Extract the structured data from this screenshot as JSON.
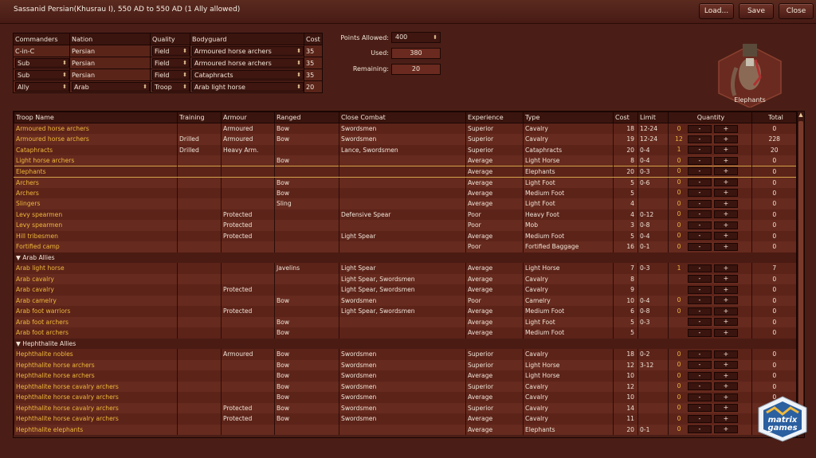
{
  "window": {
    "title": "Sassanid Persian(Khusrau I), 550 AD to 550 AD (1 Ally allowed)",
    "load": "Load...",
    "save": "Save",
    "close": "Close"
  },
  "commanders": {
    "headers": [
      "Commanders",
      "Nation",
      "Quality",
      "Bodyguard",
      "Cost"
    ],
    "rows": [
      {
        "cmd": "C-in-C",
        "nation": "Persian",
        "quality": "Field",
        "bodyguard": "Armoured horse archers",
        "cost": "35",
        "cmd_sel": false,
        "nat_sel": false
      },
      {
        "cmd": "Sub",
        "nation": "Persian",
        "quality": "Field",
        "bodyguard": "Armoured horse archers",
        "cost": "35",
        "cmd_sel": true,
        "nat_sel": false
      },
      {
        "cmd": "Sub",
        "nation": "Persian",
        "quality": "Field",
        "bodyguard": "Cataphracts",
        "cost": "35",
        "cmd_sel": true,
        "nat_sel": false
      },
      {
        "cmd": "Ally",
        "nation": "Arab",
        "quality": "Troop",
        "bodyguard": "Arab light horse",
        "cost": "20",
        "cmd_sel": true,
        "nat_sel": true
      }
    ]
  },
  "points": {
    "allowed_label": "Points Allowed:",
    "allowed": "400",
    "used_label": "Used:",
    "used": "380",
    "remaining_label": "Remaining:",
    "remaining": "20"
  },
  "unit_preview": {
    "caption": "Elephants"
  },
  "troops": {
    "headers": [
      "Troop Name",
      "Training",
      "Armour",
      "Ranged",
      "Close Combat",
      "Experience",
      "Type",
      "Cost",
      "Limit",
      "Quantity",
      "Total"
    ],
    "minus": "-",
    "plus": "+",
    "rows": [
      {
        "name": "Armoured horse archers",
        "training": "",
        "armour": "Armoured",
        "ranged": "Bow",
        "close": "Swordsmen",
        "exp": "Superior",
        "type": "Cavalry",
        "cost": "18",
        "limit": "12-24",
        "qty": "0",
        "total": "0",
        "btn": true
      },
      {
        "name": "Armoured horse archers",
        "training": "Drilled",
        "armour": "Armoured",
        "ranged": "Bow",
        "close": "Swordsmen",
        "exp": "Superior",
        "type": "Cavalry",
        "cost": "19",
        "limit": "12-24",
        "qty": "12",
        "total": "228",
        "btn": true
      },
      {
        "name": "Cataphracts",
        "training": "Drilled",
        "armour": "Heavy Arm.",
        "ranged": "",
        "close": "Lance, Swordsmen",
        "exp": "Superior",
        "type": "Cataphracts",
        "cost": "20",
        "limit": "0-4",
        "qty": "1",
        "total": "20",
        "btn": true
      },
      {
        "name": "Light horse archers",
        "training": "",
        "armour": "",
        "ranged": "Bow",
        "close": "",
        "exp": "Average",
        "type": "Light Horse",
        "cost": "8",
        "limit": "0-4",
        "qty": "0",
        "total": "0",
        "btn": true
      },
      {
        "name": "Elephants",
        "training": "",
        "armour": "",
        "ranged": "",
        "close": "",
        "exp": "Average",
        "type": "Elephants",
        "cost": "20",
        "limit": "0-3",
        "qty": "0",
        "total": "0",
        "btn": true,
        "hl": true
      },
      {
        "name": "Archers",
        "training": "",
        "armour": "",
        "ranged": "Bow",
        "close": "",
        "exp": "Average",
        "type": "Light Foot",
        "cost": "5",
        "limit": "0-6",
        "qty": "0",
        "total": "0",
        "btn": true
      },
      {
        "name": "Archers",
        "training": "",
        "armour": "",
        "ranged": "Bow",
        "close": "",
        "exp": "Average",
        "type": "Medium Foot",
        "cost": "5",
        "limit": "",
        "qty": "0",
        "total": "0",
        "btn": true
      },
      {
        "name": "Slingers",
        "training": "",
        "armour": "",
        "ranged": "Sling",
        "close": "",
        "exp": "Average",
        "type": "Light Foot",
        "cost": "4",
        "limit": "",
        "qty": "0",
        "total": "0",
        "btn": true
      },
      {
        "name": "Levy spearmen",
        "training": "",
        "armour": "Protected",
        "ranged": "",
        "close": "Defensive Spear",
        "exp": "Poor",
        "type": "Heavy Foot",
        "cost": "4",
        "limit": "0-12",
        "qty": "0",
        "total": "0",
        "btn": true
      },
      {
        "name": "Levy spearmen",
        "training": "",
        "armour": "Protected",
        "ranged": "",
        "close": "",
        "exp": "Poor",
        "type": "Mob",
        "cost": "3",
        "limit": "0-8",
        "qty": "0",
        "total": "0",
        "btn": true
      },
      {
        "name": "Hill tribesmen",
        "training": "",
        "armour": "Protected",
        "ranged": "",
        "close": "Light Spear",
        "exp": "Average",
        "type": "Medium Foot",
        "cost": "5",
        "limit": "0-4",
        "qty": "0",
        "total": "0",
        "btn": true
      },
      {
        "name": "Fortified camp",
        "training": "",
        "armour": "",
        "ranged": "",
        "close": "",
        "exp": "Poor",
        "type": "Fortified Baggage",
        "cost": "16",
        "limit": "0-1",
        "qty": "0",
        "total": "0",
        "btn": true
      },
      {
        "group": "Arab Allies"
      },
      {
        "name": "Arab light horse",
        "training": "",
        "armour": "",
        "ranged": "Javelins",
        "close": "Light Spear",
        "exp": "Average",
        "type": "Light Horse",
        "cost": "7",
        "limit": "0-3",
        "qty": "1",
        "total": "7",
        "btn": true
      },
      {
        "name": "Arab cavalry",
        "training": "",
        "armour": "",
        "ranged": "",
        "close": "Light Spear, Swordsmen",
        "exp": "Average",
        "type": "Cavalry",
        "cost": "8",
        "limit": "",
        "qty": "",
        "total": "0",
        "btn": true
      },
      {
        "name": "Arab cavalry",
        "training": "",
        "armour": "Protected",
        "ranged": "",
        "close": "Light Spear, Swordsmen",
        "exp": "Average",
        "type": "Cavalry",
        "cost": "9",
        "limit": "",
        "qty": "",
        "total": "0",
        "btn": true
      },
      {
        "name": "Arab camelry",
        "training": "",
        "armour": "",
        "ranged": "Bow",
        "close": "Swordsmen",
        "exp": "Poor",
        "type": "Camelry",
        "cost": "10",
        "limit": "0-4",
        "qty": "0",
        "total": "0",
        "btn": true
      },
      {
        "name": "Arab foot warriors",
        "training": "",
        "armour": "Protected",
        "ranged": "",
        "close": "Light Spear, Swordsmen",
        "exp": "Average",
        "type": "Medium Foot",
        "cost": "6",
        "limit": "0-8",
        "qty": "0",
        "total": "0",
        "btn": true
      },
      {
        "name": "Arab foot archers",
        "training": "",
        "armour": "",
        "ranged": "Bow",
        "close": "",
        "exp": "Average",
        "type": "Light Foot",
        "cost": "5",
        "limit": "0-3",
        "qty": "",
        "total": "0",
        "btn": true
      },
      {
        "name": "Arab foot archers",
        "training": "",
        "armour": "",
        "ranged": "Bow",
        "close": "",
        "exp": "Average",
        "type": "Medium Foot",
        "cost": "5",
        "limit": "",
        "qty": "",
        "total": "0",
        "btn": true
      },
      {
        "group": "Hephthalite Allies"
      },
      {
        "name": "Hephthalite nobles",
        "training": "",
        "armour": "Armoured",
        "ranged": "Bow",
        "close": "Swordsmen",
        "exp": "Superior",
        "type": "Cavalry",
        "cost": "18",
        "limit": "0-2",
        "qty": "0",
        "total": "0",
        "btn": true
      },
      {
        "name": "Hephthalite horse archers",
        "training": "",
        "armour": "",
        "ranged": "Bow",
        "close": "Swordsmen",
        "exp": "Superior",
        "type": "Light Horse",
        "cost": "12",
        "limit": "3-12",
        "qty": "0",
        "total": "0",
        "btn": true
      },
      {
        "name": "Hephthalite horse archers",
        "training": "",
        "armour": "",
        "ranged": "Bow",
        "close": "Swordsmen",
        "exp": "Average",
        "type": "Light Horse",
        "cost": "10",
        "limit": "",
        "qty": "0",
        "total": "0",
        "btn": true
      },
      {
        "name": "Hephthalite horse cavalry archers",
        "training": "",
        "armour": "",
        "ranged": "Bow",
        "close": "Swordsmen",
        "exp": "Superior",
        "type": "Cavalry",
        "cost": "12",
        "limit": "",
        "qty": "0",
        "total": "0",
        "btn": true
      },
      {
        "name": "Hephthalite horse cavalry archers",
        "training": "",
        "armour": "",
        "ranged": "Bow",
        "close": "Swordsmen",
        "exp": "Average",
        "type": "Cavalry",
        "cost": "10",
        "limit": "",
        "qty": "0",
        "total": "0",
        "btn": true
      },
      {
        "name": "Hephthalite horse cavalry archers",
        "training": "",
        "armour": "Protected",
        "ranged": "Bow",
        "close": "Swordsmen",
        "exp": "Superior",
        "type": "Cavalry",
        "cost": "14",
        "limit": "",
        "qty": "0",
        "total": "0",
        "btn": true
      },
      {
        "name": "Hephthalite horse cavalry archers",
        "training": "",
        "armour": "Protected",
        "ranged": "Bow",
        "close": "Swordsmen",
        "exp": "Average",
        "type": "Cavalry",
        "cost": "11",
        "limit": "",
        "qty": "0",
        "total": "0",
        "btn": true
      },
      {
        "name": "Hephthalite elephants",
        "training": "",
        "armour": "",
        "ranged": "",
        "close": "",
        "exp": "Average",
        "type": "Elephants",
        "cost": "20",
        "limit": "0-1",
        "qty": "0",
        "total": "0",
        "btn": true
      }
    ]
  },
  "logo": {
    "line1": "matrix",
    "line2": "games"
  },
  "colors": {
    "background": "#4a1e16",
    "accent": "#f0b93c",
    "highlight": "#d5a24a"
  }
}
